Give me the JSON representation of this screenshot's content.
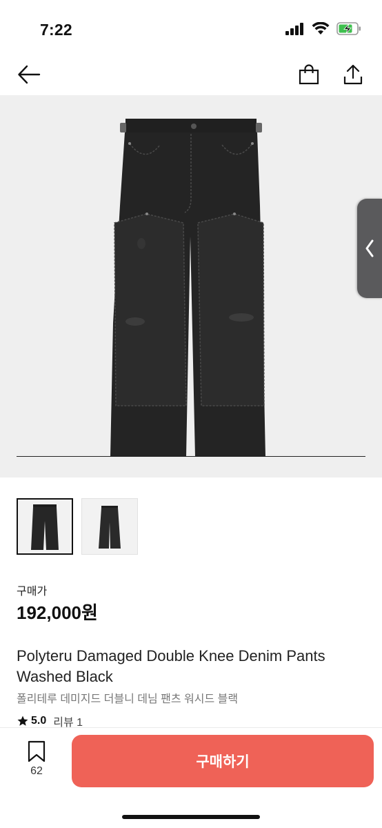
{
  "status_bar": {
    "time": "7:22"
  },
  "nav": {
    "back_icon": "arrow-left-icon",
    "shop_icon": "shopping-bag-icon",
    "share_icon": "share-icon"
  },
  "hero": {
    "image_subject": "black-double-knee-denim-pants",
    "side_handle_icon": "chevron-left-icon"
  },
  "thumbnails": [
    {
      "selected": true
    },
    {
      "selected": false
    }
  ],
  "product": {
    "price_label": "구매가",
    "price": "192,000원",
    "title": "Polyteru Damaged Double Knee Denim Pants Washed Black",
    "subtitle": "폴리테루 데미지드 더블니 데님 팬츠 워시드 블랙",
    "rating": "5.0",
    "review_label": "리뷰 1"
  },
  "bottom_bar": {
    "save_count": "62",
    "buy_label": "구매하기"
  },
  "colors": {
    "accent": "#ef6257",
    "hero_bg": "#efefef",
    "denim": "#242424"
  }
}
